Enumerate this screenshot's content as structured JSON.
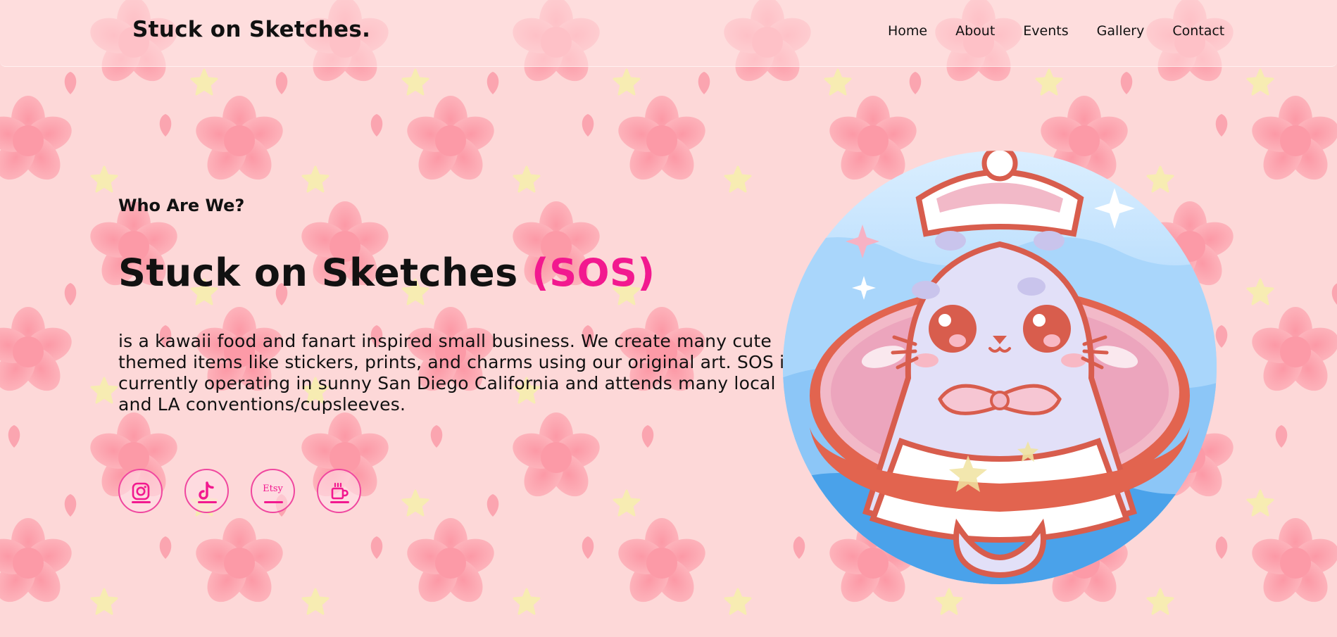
{
  "colors": {
    "background": "#fdd8d8",
    "accent": "#f2198f",
    "flower": "#fba5b0",
    "star": "#f7ecb2"
  },
  "header": {
    "brand": "Stuck on Sketches.",
    "nav": [
      {
        "label": "Home"
      },
      {
        "label": "About"
      },
      {
        "label": "Events"
      },
      {
        "label": "Gallery"
      },
      {
        "label": "Contact"
      }
    ]
  },
  "about": {
    "kicker": "Who Are We?",
    "headline": "Stuck on Sketches ",
    "headline_accent": "(SOS)",
    "description": "is a kawaii food and fanart inspired small business. We create many cute themed items like stickers, prints, and charms using our original art. SOS is currently operating in sunny San Diego California and attends many local and LA conventions/cupsleeves."
  },
  "socials": [
    {
      "icon": "instagram-icon"
    },
    {
      "icon": "tiktok-icon"
    },
    {
      "icon": "etsy-icon",
      "text": "Etsy"
    },
    {
      "icon": "ko-fi-cup-icon"
    }
  ],
  "hero": {
    "icon": "seal-mascot-illustration"
  }
}
